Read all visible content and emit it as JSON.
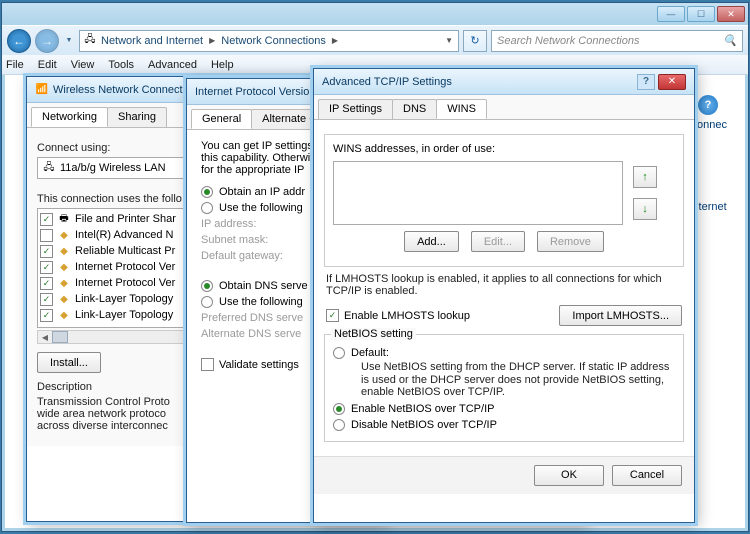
{
  "explorer": {
    "breadcrumb": [
      "Network and Internet",
      "Network Connections"
    ],
    "search_placeholder": "Search Network Connections",
    "menu": [
      "File",
      "Edit",
      "View",
      "Tools",
      "Advanced",
      "Help"
    ],
    "sidebar": {
      "connec": "Connec",
      "internet": "Internet"
    }
  },
  "dlg1": {
    "title": "Wireless Network Connect",
    "tabs": [
      "Networking",
      "Sharing"
    ],
    "connect_using_label": "Connect using:",
    "adapter": "11a/b/g Wireless LAN",
    "list_label": "This connection uses the follo",
    "items": [
      {
        "chk": true,
        "label": "File and Printer Shar"
      },
      {
        "chk": false,
        "label": "Intel(R) Advanced N"
      },
      {
        "chk": true,
        "label": "Reliable Multicast Pr"
      },
      {
        "chk": true,
        "label": "Internet Protocol Ver"
      },
      {
        "chk": true,
        "label": "Internet Protocol Ver"
      },
      {
        "chk": true,
        "label": "Link-Layer Topology"
      },
      {
        "chk": true,
        "label": "Link-Layer Topology"
      }
    ],
    "install_btn": "Install...",
    "desc_label": "Description",
    "desc_text": "Transmission Control Proto\nwide area network protoco\nacross diverse interconnec"
  },
  "dlg2": {
    "title": "Internet Protocol Version",
    "tabs": [
      "General",
      "Alternate Con"
    ],
    "intro": "You can get IP settings\nthis capability. Otherwi\nfor the appropriate IP",
    "r1": "Obtain an IP addr",
    "r2": "Use the following",
    "ip_label": "IP address:",
    "subnet_label": "Subnet mask:",
    "gateway_label": "Default gateway:",
    "r3": "Obtain DNS serve",
    "r4": "Use the following",
    "pref_dns": "Preferred DNS serve",
    "alt_dns": "Alternate DNS serve",
    "validate": "Validate settings"
  },
  "dlg3": {
    "title": "Advanced TCP/IP Settings",
    "tabs": [
      "IP Settings",
      "DNS",
      "WINS"
    ],
    "wins_label": "WINS addresses, in order of use:",
    "add": "Add...",
    "edit": "Edit...",
    "remove": "Remove",
    "lmhosts_note": "If LMHOSTS lookup is enabled, it applies to all connections for which TCP/IP is enabled.",
    "enable_lmhosts": "Enable LMHOSTS lookup",
    "import_lmhosts": "Import LMHOSTS...",
    "netbios_group": "NetBIOS setting",
    "nb_default": "Default:",
    "nb_default_sub": "Use NetBIOS setting from the DHCP server. If static IP address is used or the DHCP server does not provide NetBIOS setting, enable NetBIOS over TCP/IP.",
    "nb_enable": "Enable NetBIOS over TCP/IP",
    "nb_disable": "Disable NetBIOS over TCP/IP",
    "ok": "OK",
    "cancel": "Cancel"
  }
}
